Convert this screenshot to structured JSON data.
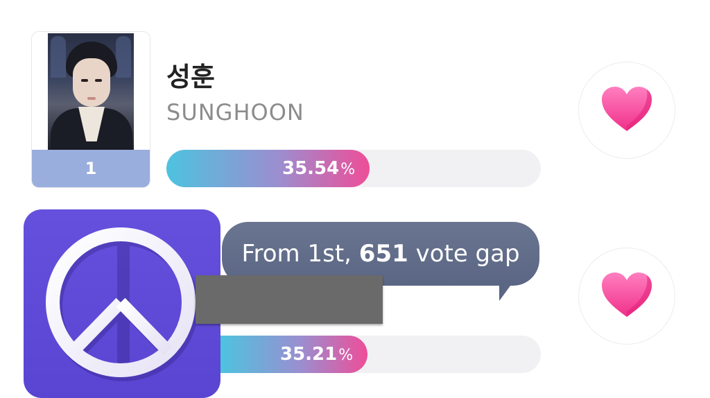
{
  "items": [
    {
      "rank": "1",
      "name_ko": "성훈",
      "name_en": "SUNGHOON",
      "percent_value": "35.54",
      "percent_sign": "%",
      "percent": 35.54
    },
    {
      "percent_value": "35.21",
      "percent_sign": "%",
      "percent": 35.21
    }
  ],
  "tooltip": {
    "prefix": "From 1st, ",
    "gap": "651",
    "suffix": " vote gap"
  },
  "icons": {
    "heart": "heart-icon",
    "peace": "peace-sign-icon"
  },
  "colors": {
    "heart": "#ff4fa3",
    "rank_strip": "#99aedd",
    "peace_bg": "#6550dd",
    "tooltip_bg": "#5f6b88"
  }
}
